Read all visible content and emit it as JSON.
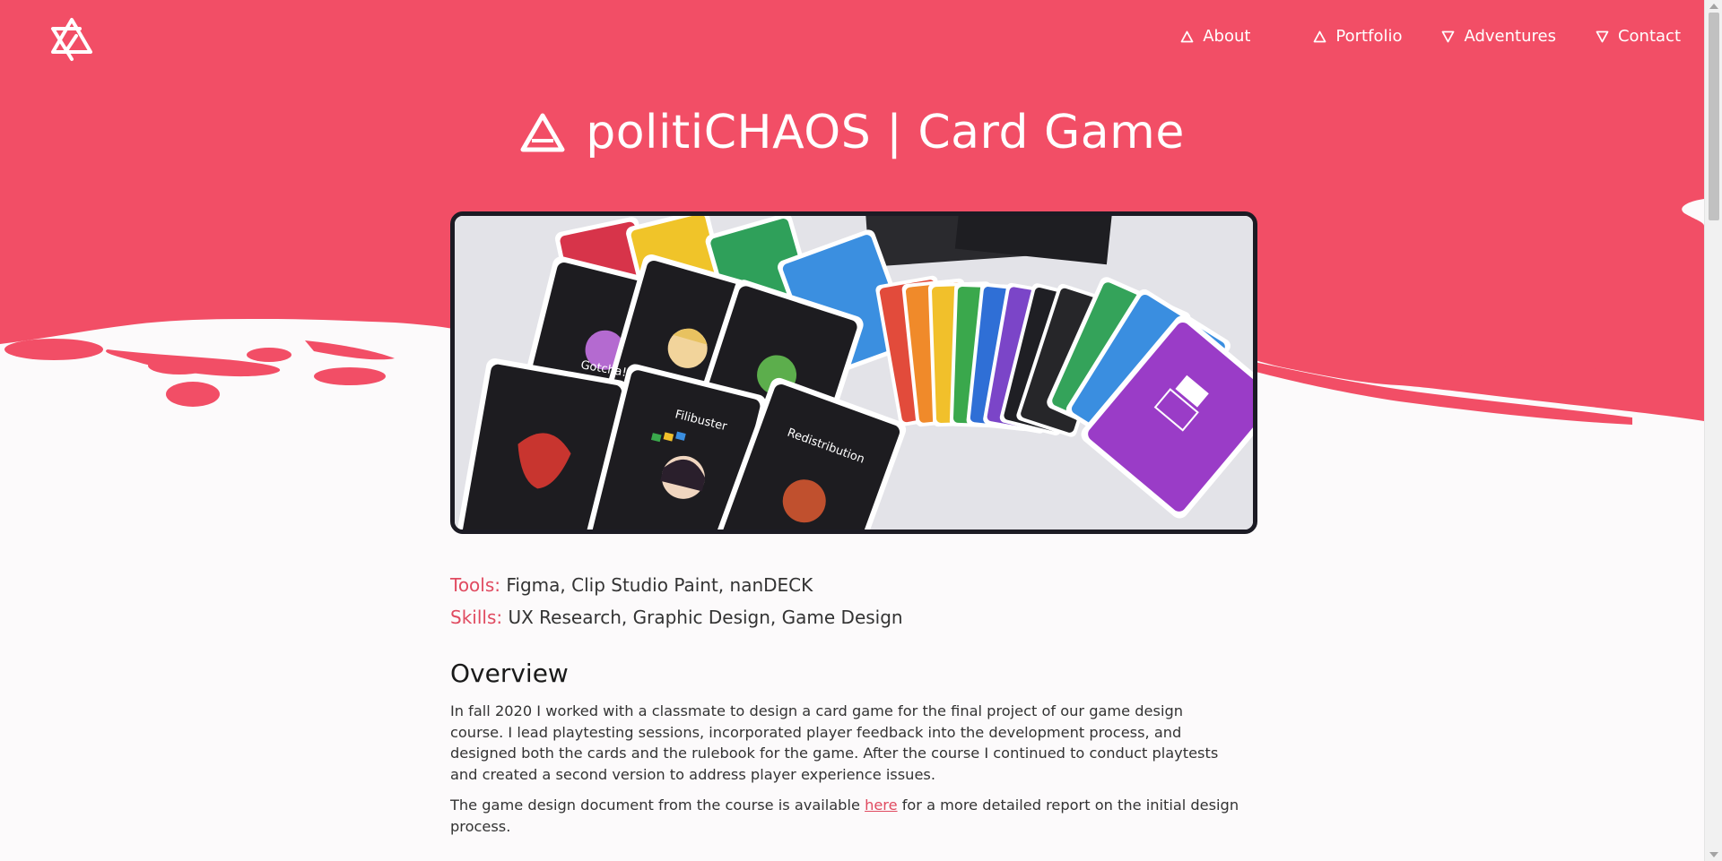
{
  "nav": {
    "items": [
      {
        "label": "About",
        "icon": "triangle-up-icon"
      },
      {
        "label": "Portfolio",
        "icon": "triangle-up-icon"
      },
      {
        "label": "Adventures",
        "icon": "triangle-down-icon"
      },
      {
        "label": "Contact",
        "icon": "triangle-down-icon"
      }
    ]
  },
  "page": {
    "title": "politiCHAOS | Card Game",
    "hero_image": "card-game-photo"
  },
  "meta": {
    "tools_label": "Tools:",
    "tools_value": "Figma, Clip Studio Paint, nanDECK",
    "skills_label": "Skills:",
    "skills_value": "UX Research, Graphic Design, Game Design"
  },
  "overview": {
    "heading": "Overview",
    "paragraph1": "In fall 2020 I worked with a classmate to design a card game for the final project of our game design course. I lead playtesting sessions, incorporated player feedback into the development process, and designed both the cards and the rulebook for the game. After the course I continued to conduct playtests and created a second version to address player experience issues.",
    "paragraph2_before": "The game design document from the course is available ",
    "paragraph2_link": "here",
    "paragraph2_after": " for a more detailed report on the initial design process."
  },
  "colors": {
    "brand": "#f24e66",
    "accent_text": "#e04a60",
    "background": "#fcfafb",
    "frame": "#1c1b24"
  }
}
